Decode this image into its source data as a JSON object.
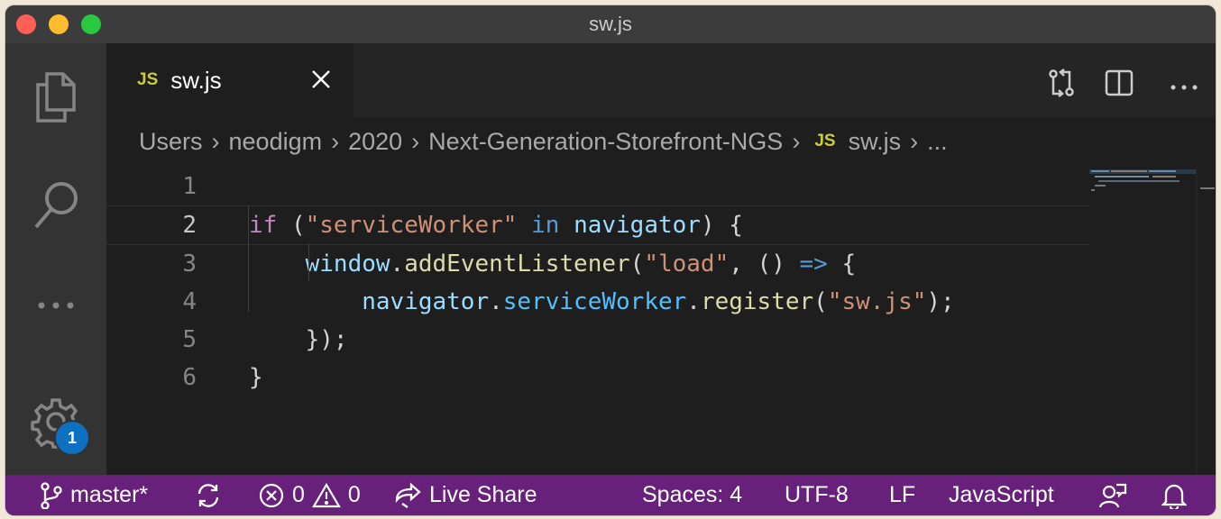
{
  "window": {
    "title": "sw.js"
  },
  "tabs": [
    {
      "icon": "JS",
      "label": "sw.js"
    }
  ],
  "breadcrumb": {
    "items": [
      "Users",
      "neodigm",
      "2020",
      "Next-Generation-Storefront-NGS"
    ],
    "file_icon": "JS",
    "file": "sw.js",
    "more": "..."
  },
  "editor": {
    "line_numbers": [
      "1",
      "2",
      "3",
      "4",
      "5",
      "6"
    ],
    "lines": [
      [],
      [
        {
          "t": "if",
          "c": "k-purple"
        },
        {
          "t": " (",
          "c": "p-text"
        },
        {
          "t": "\"serviceWorker\"",
          "c": "s-str"
        },
        {
          "t": " ",
          "c": "p-text"
        },
        {
          "t": "in",
          "c": "k-blue"
        },
        {
          "t": " ",
          "c": "p-text"
        },
        {
          "t": "navigator",
          "c": "v-var"
        },
        {
          "t": ") {",
          "c": "p-text"
        }
      ],
      [
        {
          "t": "    ",
          "c": "p-text"
        },
        {
          "t": "window",
          "c": "v-var"
        },
        {
          "t": ".",
          "c": "p-text"
        },
        {
          "t": "addEventListener",
          "c": "f-fn"
        },
        {
          "t": "(",
          "c": "p-text"
        },
        {
          "t": "\"load\"",
          "c": "s-str"
        },
        {
          "t": ", () ",
          "c": "p-text"
        },
        {
          "t": "=>",
          "c": "k-blue"
        },
        {
          "t": " {",
          "c": "p-text"
        }
      ],
      [
        {
          "t": "        ",
          "c": "p-text"
        },
        {
          "t": "navigator",
          "c": "v-var"
        },
        {
          "t": ".",
          "c": "p-text"
        },
        {
          "t": "serviceWorker",
          "c": "v-const"
        },
        {
          "t": ".",
          "c": "p-text"
        },
        {
          "t": "register",
          "c": "f-fn"
        },
        {
          "t": "(",
          "c": "p-text"
        },
        {
          "t": "\"sw.js\"",
          "c": "s-str"
        },
        {
          "t": ");",
          "c": "p-text"
        }
      ],
      [
        {
          "t": "    });",
          "c": "p-text"
        }
      ],
      [
        {
          "t": "}",
          "c": "p-text"
        }
      ]
    ]
  },
  "activity": {
    "settings_badge": "1"
  },
  "statusbar": {
    "branch": "master*",
    "errors": "0",
    "warnings": "0",
    "live_share": "Live Share",
    "spaces": "Spaces: 4",
    "encoding": "UTF-8",
    "eol": "LF",
    "language": "JavaScript"
  },
  "colors": {
    "statusbar_bg": "#68217a",
    "badge_bg": "#0e70c0",
    "js_icon": "#cbcb41"
  },
  "icons": {
    "activity": [
      "files-icon",
      "search-icon",
      "more-icon",
      "gear-icon"
    ],
    "editor_actions": [
      "open-changes-icon",
      "split-editor-icon",
      "more-actions-icon"
    ],
    "statusbar": [
      "git-branch-icon",
      "sync-icon",
      "error-icon",
      "warning-icon",
      "live-share-icon",
      "feedback-icon",
      "bell-icon"
    ]
  }
}
